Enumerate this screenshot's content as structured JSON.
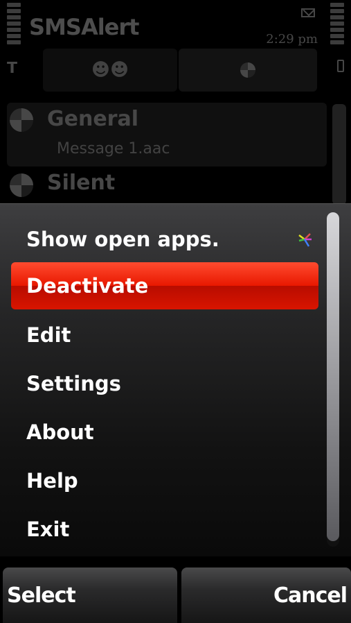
{
  "app": {
    "title": "SMSAlert",
    "time": "2:29 pm"
  },
  "background_list": {
    "items": [
      {
        "name": "General",
        "subtitle": "Message 1.aac"
      },
      {
        "name": "Silent"
      }
    ]
  },
  "menu": {
    "items": [
      {
        "label": "Show open apps.",
        "icon": "open-apps-icon"
      },
      {
        "label": "Deactivate",
        "selected": true
      },
      {
        "label": "Edit"
      },
      {
        "label": "Settings"
      },
      {
        "label": "About"
      },
      {
        "label": "Help"
      },
      {
        "label": "Exit"
      }
    ]
  },
  "softkeys": {
    "left_label": "Select",
    "right_label": "Cancel"
  },
  "colors": {
    "selection_red": "#e81800",
    "background": "#000000"
  }
}
